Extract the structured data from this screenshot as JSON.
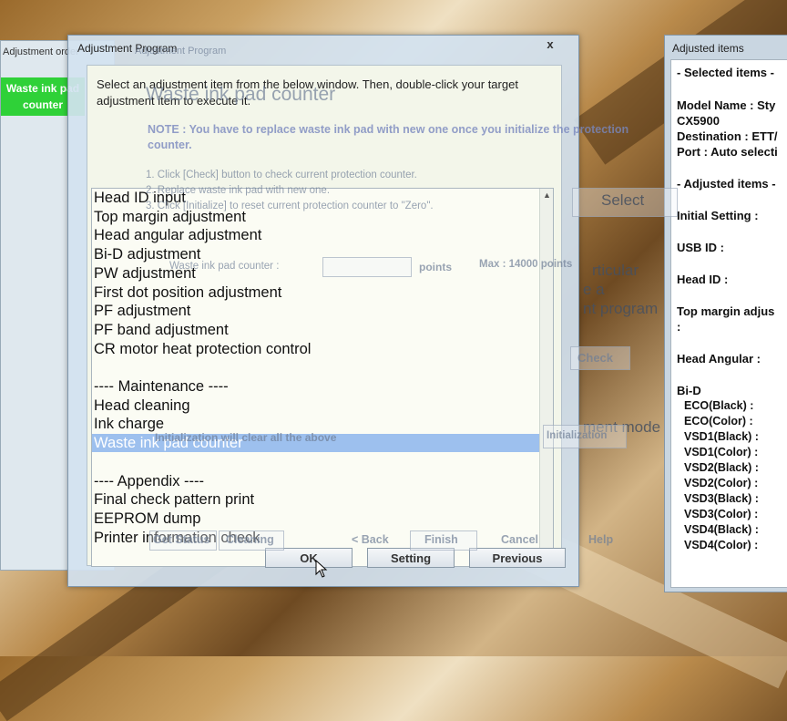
{
  "left_window": {
    "title": "Adjustment order",
    "selected_item": "Waste ink pad counter"
  },
  "main_dialog": {
    "title": "Adjustment Program",
    "close": "x",
    "instruction": "Select an adjustment item from the below window. Then, double-click your target adjustment item to execute it.",
    "list_items": [
      "Head ID input",
      "Top margin adjustment",
      "Head angular adjustment",
      "Bi-D adjustment",
      "PW adjustment",
      "First dot position adjustment",
      "PF adjustment",
      "PF band adjustment",
      "CR motor heat protection control",
      "",
      "---- Maintenance ----",
      "Head cleaning",
      "Ink charge",
      "Waste ink pad counter",
      "",
      "---- Appendix ----",
      "Final check pattern print",
      "EEPROM dump",
      "Printer information check"
    ],
    "selected_index": 13,
    "buttons": {
      "ok": "OK",
      "setting": "Setting",
      "previous": "Previous"
    }
  },
  "ghost_window": {
    "title": "Adjustment Program",
    "heading": "Waste ink pad counter",
    "note": "NOTE : You have to replace waste ink pad with new one once you initialize the protection counter.",
    "step1": "1. Click [Check] button to check current protection counter.",
    "step2": "2. Replace waste ink pad with new one.",
    "step3": "3. Click [Initialize] to reset current protection counter to \"Zero\".",
    "counter_label": "Waste ink pad counter :",
    "counter_unit": "points",
    "max_label": "Max : 14000 points",
    "initialization_note": "Initialization will clear all the above",
    "select_btn": "Select",
    "particular": "rticular",
    "tea": "e a",
    "program": "nt program",
    "check_btn": "Check",
    "mode": "ment mode",
    "initialization_btn": "Initialization",
    "buttons": [
      "Get Status",
      "Cleaning",
      "< Back",
      "Finish",
      "Cancel",
      "Help"
    ]
  },
  "right_window": {
    "title": "Adjusted items",
    "selected_header": "- Selected items -",
    "model_name": "Model Name : Sty",
    "model_value": "CX5900",
    "destination": "Destination : ETT/",
    "port": "Port : Auto selecti",
    "adjusted_header": "- Adjusted items -",
    "initial_setting": "Initial Setting :",
    "usb_id": "USB ID :",
    "head_id": "Head ID :",
    "top_margin": "Top margin adjus",
    "colon": ":",
    "head_angular": "Head Angular :",
    "bid": "Bi-D",
    "bid_items": [
      "ECO(Black)  :",
      "ECO(Color)  :",
      "VSD1(Black) :",
      "VSD1(Color) :",
      "VSD2(Black) :",
      "VSD2(Color) :",
      "VSD3(Black) :",
      "VSD3(Color) :",
      "VSD4(Black) :",
      "VSD4(Color) :"
    ]
  }
}
